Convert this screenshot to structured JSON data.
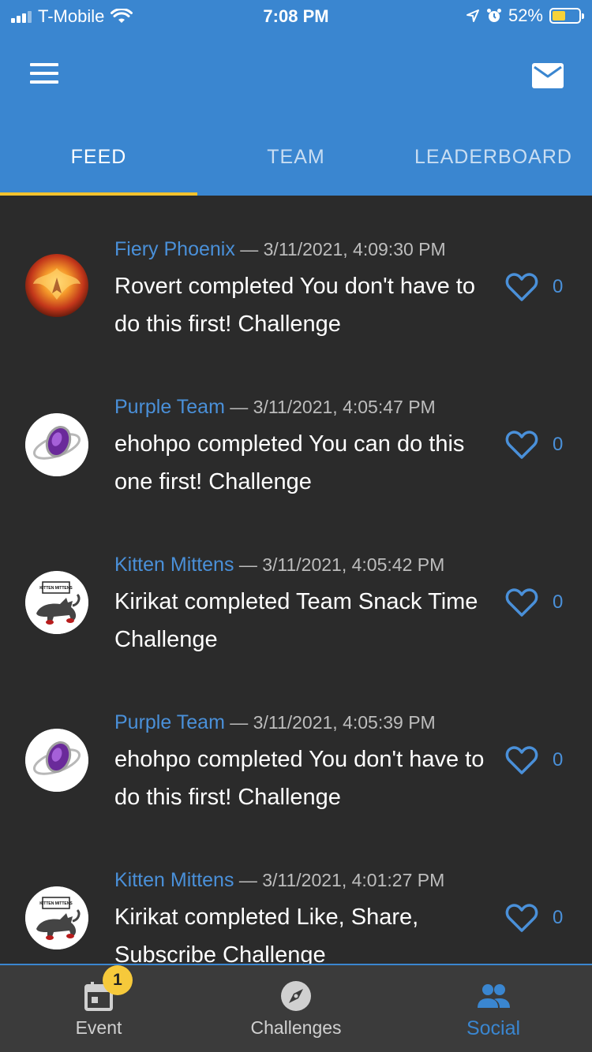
{
  "status_bar": {
    "carrier": "T-Mobile",
    "time": "7:08 PM",
    "battery": "52%"
  },
  "header": {
    "menu_icon": "menu-icon",
    "mail_icon": "mail-icon",
    "accent_color": "#3a86d0",
    "indicator_color": "#f2c22e"
  },
  "tabs": [
    {
      "label": "FEED",
      "active": true
    },
    {
      "label": "TEAM",
      "active": false
    },
    {
      "label": "LEADERBOARD",
      "active": false
    }
  ],
  "feed": [
    {
      "team": "Fiery Phoenix",
      "timestamp": "— 3/11/2021, 4:09:30 PM",
      "message": "Rovert completed You don't have to do this first! Challenge",
      "likes": "0",
      "avatar": "phoenix"
    },
    {
      "team": "Purple Team",
      "timestamp": "— 3/11/2021, 4:05:47 PM",
      "message": "ehohpo completed You can do this one first! Challenge",
      "likes": "0",
      "avatar": "ring"
    },
    {
      "team": "Kitten Mittens",
      "timestamp": "— 3/11/2021, 4:05:42 PM",
      "message": "Kirikat completed Team Snack Time Challenge",
      "likes": "0",
      "avatar": "kitten"
    },
    {
      "team": "Purple Team",
      "timestamp": "— 3/11/2021, 4:05:39 PM",
      "message": "ehohpo completed You don't have to do this first! Challenge",
      "likes": "0",
      "avatar": "ring"
    },
    {
      "team": "Kitten Mittens",
      "timestamp": "— 3/11/2021, 4:01:27 PM",
      "message": "Kirikat completed Like, Share, Subscribe Challenge",
      "likes": "0",
      "avatar": "kitten"
    }
  ],
  "avatar_text": {
    "kitten_logo": "KITTEN MITTENS"
  },
  "bottom_nav": [
    {
      "label": "Event",
      "icon": "calendar-icon",
      "badge": "1",
      "active": false
    },
    {
      "label": "Challenges",
      "icon": "compass-icon",
      "active": false
    },
    {
      "label": "Social",
      "icon": "people-icon",
      "active": true
    }
  ]
}
